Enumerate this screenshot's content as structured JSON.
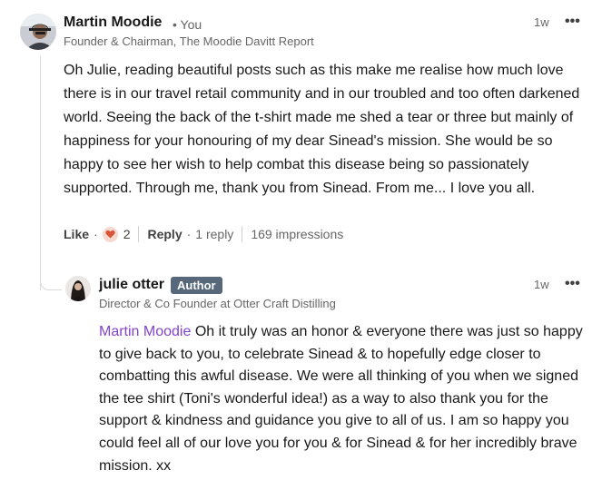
{
  "comment": {
    "author": "Martin Moodie",
    "you_label": "• You",
    "headline": "Founder & Chairman, The Moodie Davitt Report",
    "time": "1w",
    "more_label": "•••",
    "text": "Oh Julie, reading beautiful posts such as this make me realise how much love there is in our travel retail community and in our troubled and too often darkened world. Seeing the back of the t-shirt made me shed a tear or three but mainly of happiness for your honouring of my dear Sinead's mission. She would be so happy to see her wish to help combat this disease being so passionately supported. Through me, thank you from Sinead. From me... I love you all.",
    "actions": {
      "like_label": "Like",
      "dot": "·",
      "reaction_count": "2",
      "reply_label": "Reply",
      "reply_count": "1 reply",
      "impressions": "169 impressions"
    }
  },
  "reply": {
    "author": "julie otter",
    "badge": "Author",
    "headline": "Director & Co Founder at Otter Craft Distilling",
    "time": "1w",
    "more_label": "•••",
    "mention": "Martin Moodie",
    "text": " Oh it truly was an honor & everyone there was just so happy to give back to you, to celebrate Sinead & to hopefully edge closer to combatting this awful disease. We were all thinking of you when we signed the tee shirt (Toni's wonderful idea!) as a way to also thank you for the support & kindness and guidance you give to all of us. I am so happy you could feel all of our love you for you & for Sinead & for her incredibly brave mission. xx"
  },
  "colors": {
    "mention": "#8344cc",
    "badge_bg": "#56687a",
    "heart": "#d8553a"
  },
  "icons": [
    "avatar-martin",
    "heart-icon",
    "avatar-julie",
    "more-icon"
  ]
}
